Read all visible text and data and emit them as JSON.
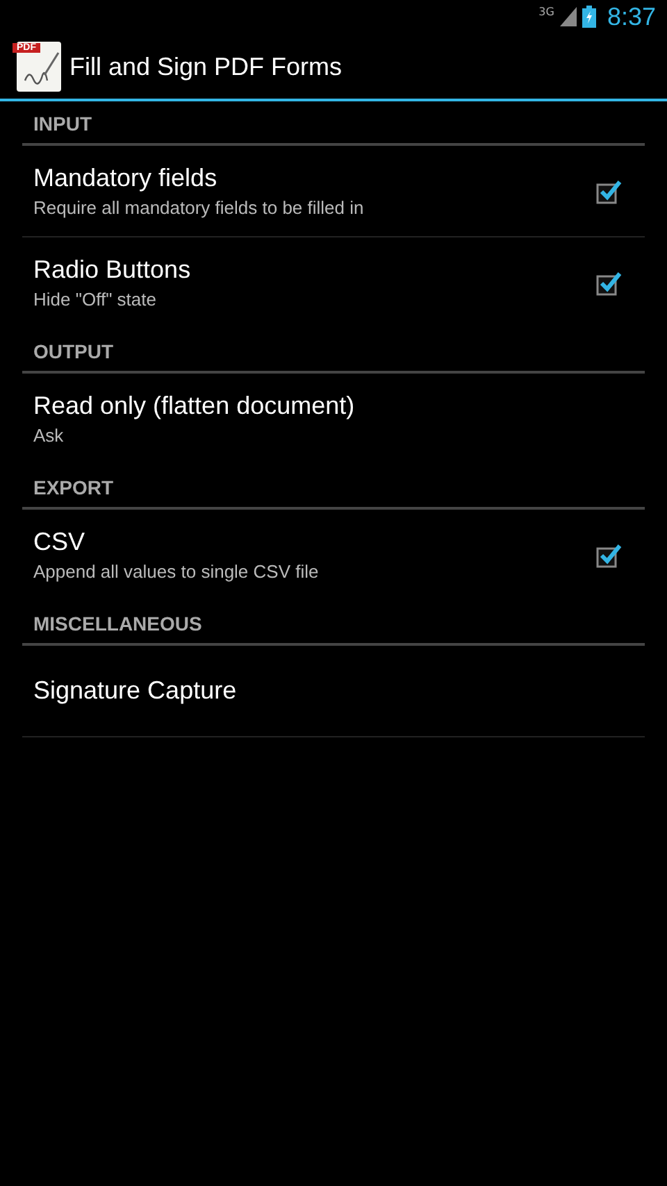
{
  "status_bar": {
    "network": "3G",
    "time": "8:37"
  },
  "action_bar": {
    "icon_label": "PDF",
    "title": "Fill and Sign PDF Forms"
  },
  "sections": [
    {
      "title": "INPUT",
      "items": [
        {
          "kind": "checkbox",
          "title": "Mandatory fields",
          "summary": "Require all mandatory fields to be filled in",
          "checked": true
        },
        {
          "kind": "checkbox",
          "title": "Radio Buttons",
          "summary": "Hide \"Off\" state",
          "checked": true
        }
      ]
    },
    {
      "title": "OUTPUT",
      "items": [
        {
          "kind": "plain",
          "title": "Read only (flatten document)",
          "summary": "Ask"
        }
      ]
    },
    {
      "title": "EXPORT",
      "items": [
        {
          "kind": "checkbox",
          "title": "CSV",
          "summary": "Append all values to single CSV file",
          "checked": true
        }
      ]
    },
    {
      "title": "MISCELLANEOUS",
      "items": [
        {
          "kind": "plain",
          "title": "Signature Capture"
        }
      ]
    }
  ]
}
